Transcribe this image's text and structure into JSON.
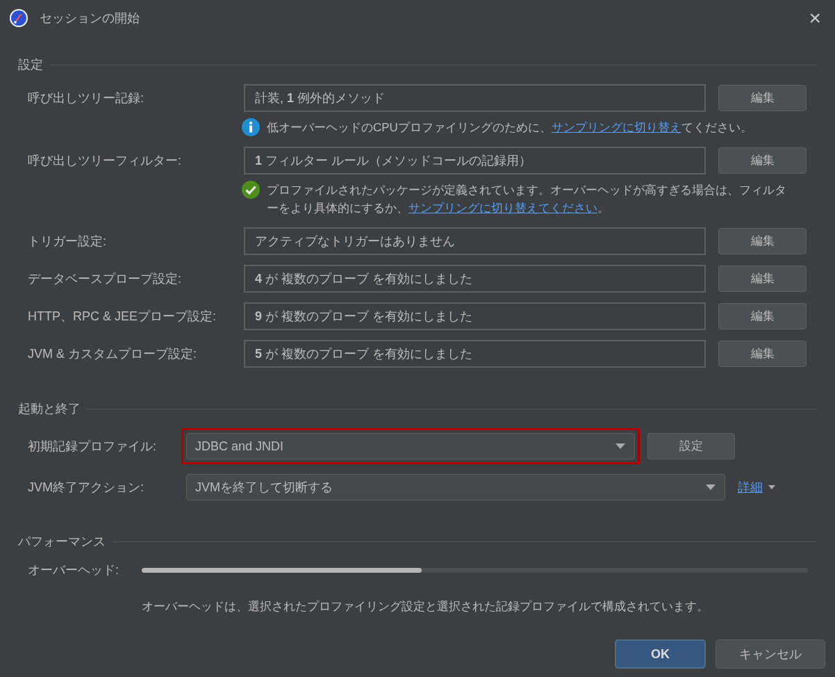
{
  "window": {
    "title": "セッションの開始",
    "close": "×"
  },
  "sections": [
    {
      "title": "設定",
      "rows": [
        {
          "kind": "field",
          "label": "呼び出しツリー記録:",
          "value": "計装, **1** 例外的メソッド",
          "button": "編集",
          "hint": {
            "kind": "info",
            "parts": [
              {
                "text": "低オーバーヘッドのCPUプロファイリングのために、",
                "link": false
              },
              {
                "text": "サンプリングに切り替え",
                "link": true
              },
              {
                "text": "てください。",
                "link": false
              }
            ]
          }
        },
        {
          "kind": "field",
          "label": "呼び出しツリーフィルター:",
          "value": "**1** フィルター ルール（メソッドコールの記録用）",
          "button": "編集",
          "hint": {
            "kind": "ok",
            "parts": [
              {
                "text": "プロファイルされたパッケージが定義されています。オーバーヘッドが高すぎる場合は、フィルターをより具体的にするか、",
                "link": false
              },
              {
                "text": "サンプリングに切り替えてください",
                "link": true
              },
              {
                "text": "。",
                "link": false
              }
            ]
          }
        },
        {
          "kind": "field",
          "label": "トリガー設定:",
          "value": "アクティブなトリガーはありません",
          "button": "編集"
        },
        {
          "kind": "field",
          "label": "データベースプローブ設定:",
          "value": "**4** が 複数のプローブ を有効にしました",
          "button": "編集"
        },
        {
          "kind": "field",
          "label": "HTTP、RPC & JEEプローブ設定:",
          "value": "**9** が 複数のプローブ を有効にしました",
          "button": "編集"
        },
        {
          "kind": "field",
          "label": "JVM & カスタムプローブ設定:",
          "value": "**5** が 複数のプローブ を有効にしました",
          "button": "編集"
        }
      ]
    },
    {
      "title": "起動と終了",
      "rows": [
        {
          "kind": "combo",
          "label": "初期記録プロファイル:",
          "value": "JDBC and JNDI",
          "highlighted": true,
          "button": "設定"
        },
        {
          "kind": "combo",
          "label": "JVM終了アクション:",
          "value": "JVMを終了して切断する",
          "highlighted": false,
          "link": "詳細"
        }
      ]
    },
    {
      "title": "パフォーマンス",
      "rows": [
        {
          "kind": "meter",
          "label": "オーバーヘッド:",
          "level": 0.42,
          "note": "オーバーヘッドは、選択されたプロファイリング設定と選択された記録プロファイルで構成されています。"
        }
      ]
    }
  ],
  "buttons": [
    {
      "label": "OK",
      "default": true
    },
    {
      "label": "キャンセル",
      "default": false
    }
  ]
}
